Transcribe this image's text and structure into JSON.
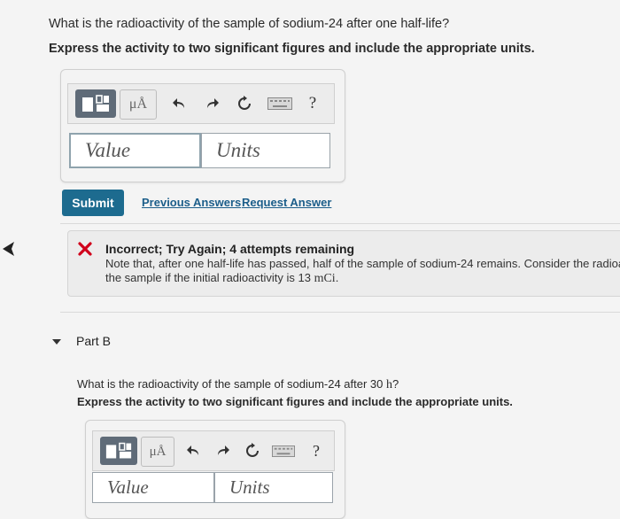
{
  "partA": {
    "question": "What is the radioactivity of the sample of sodium-24 after one half-life?",
    "instruction": "Express the activity to two significant figures and include the appropriate units.",
    "toolbar": {
      "mu_label": "μÅ",
      "help_label": "?"
    },
    "value_placeholder": "Value",
    "units_placeholder": "Units",
    "submit_label": "Submit",
    "previous_answers_label": "Previous Answers",
    "request_answer_label": "Request Answer",
    "feedback": {
      "status": "Incorrect; Try Again; 4 attempts remaining",
      "note_prefix": "Note that, after one half-life has passed, half of the sample of sodium-24 remains. Consider the radioactivity of",
      "note_mid": "the sample if the initial radioactivity is 13",
      "note_unit": "mCi",
      "note_end": "."
    }
  },
  "partB": {
    "title": "Part B",
    "question_prefix": "What is the radioactivity of the sample of sodium-24 after 30",
    "question_unit": "h",
    "question_end": "?",
    "instruction": "Express the activity to two significant figures and include the appropriate units.",
    "toolbar": {
      "mu_label": "μÅ",
      "help_label": "?"
    },
    "value_placeholder": "Value",
    "units_placeholder": "Units"
  }
}
